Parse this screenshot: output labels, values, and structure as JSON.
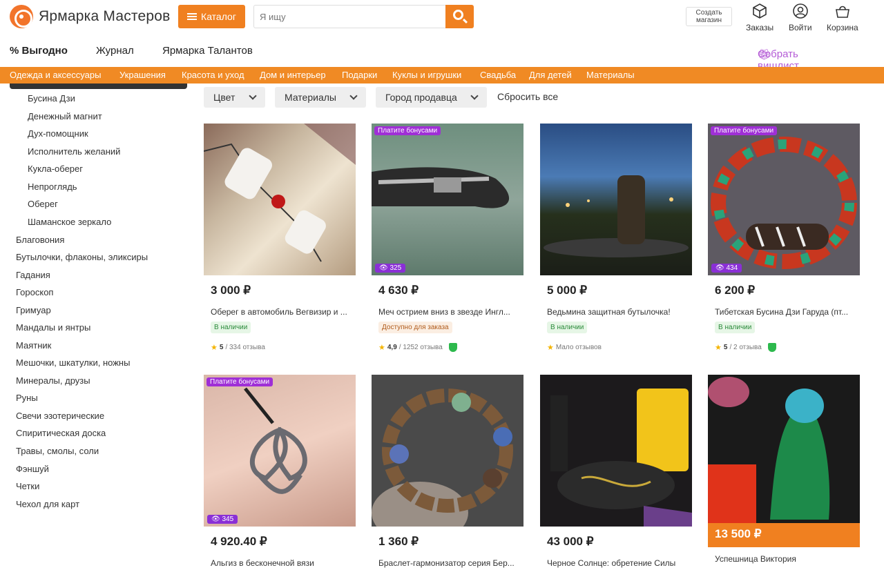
{
  "header": {
    "logo_text": "Ярмарка Мастеров",
    "catalog_label": "Каталог",
    "search_placeholder": "Я ищу",
    "create_shop_label": "Создать магазин",
    "orders_label": "Заказы",
    "login_label": "Войти",
    "cart_label": "Корзина"
  },
  "subnav": {
    "deals": "% Выгодно",
    "journal": "Журнал",
    "talents": "Ярмарка Талантов",
    "wishlist": "Собрать вишлист"
  },
  "categories": [
    "Одежда и аксессуары",
    "Украшения",
    "Красота и уход",
    "Дом и интерьер",
    "Подарки",
    "Куклы и игрушки",
    "Свадьба",
    "Для детей",
    "Материалы"
  ],
  "sidebar": {
    "subitems": [
      "Бусина Дзи",
      "Денежный магнит",
      "Дух-помощник",
      "Исполнитель желаний",
      "Кукла-оберег",
      "Непроглядь",
      "Оберег",
      "Шаманское зеркало"
    ],
    "items": [
      "Благовония",
      "Бутылочки, флаконы, эликсиры",
      "Гадания",
      "Гороскоп",
      "Гримуар",
      "Мандалы и янтры",
      "Маятник",
      "Мешочки, шкатулки, ножны",
      "Минералы, друзы",
      "Руны",
      "Свечи эзотерические",
      "Спиритическая доска",
      "Травы, смолы, соли",
      "Фэншуй",
      "Четки",
      "Чехол для карт"
    ]
  },
  "filters": {
    "color": "Цвет",
    "materials": "Материалы",
    "city": "Город продавца",
    "reset": "Сбросить все"
  },
  "products": [
    {
      "price": "3 000 ₽",
      "title": "Оберег в автомобиль Вегвизир и ...",
      "stock": "В наличии",
      "rating": "5",
      "reviews": "/ 334 отзыва",
      "bonus": "",
      "views": ""
    },
    {
      "price": "4 630 ₽",
      "title": "Меч острием вниз в звезде Ингл...",
      "stock": "Доступно для заказа",
      "rating": "4,9",
      "reviews": "/ 1252 отзыва",
      "bonus": "Платите бонусами",
      "views": "325"
    },
    {
      "price": "5 000 ₽",
      "title": "Ведьмина защитная бутылочка!",
      "stock": "В наличии",
      "rating": "",
      "reviews": "Мало отзывов",
      "bonus": "",
      "views": ""
    },
    {
      "price": "6 200 ₽",
      "title": "Тибетская Бусина Дзи Гаруда (пт...",
      "stock": "В наличии",
      "rating": "5",
      "reviews": "/ 2 отзыва",
      "bonus": "Платите бонусами",
      "views": "434"
    },
    {
      "price": "4 920.40 ₽",
      "title": "Альгиз в бесконечной вязи",
      "bonus": "Платите бонусами",
      "views": "345"
    },
    {
      "price": "1 360 ₽",
      "title": "Браслет-гармонизатор серия Бер...",
      "bonus": "",
      "views": ""
    },
    {
      "price": "43 000 ₽",
      "title": "Черное Солнце: обретение Силы",
      "bonus": "",
      "views": ""
    },
    {
      "price": "13 500 ₽",
      "title": "Успешница Виктория",
      "bonus": "",
      "views": ""
    }
  ],
  "colors": {
    "accent": "#f08020",
    "bonus": "#9f2fd6",
    "wishlist": "#b45bd6",
    "in_stock_bg": "#e6f6e6",
    "order_bg": "#fbeee2"
  }
}
